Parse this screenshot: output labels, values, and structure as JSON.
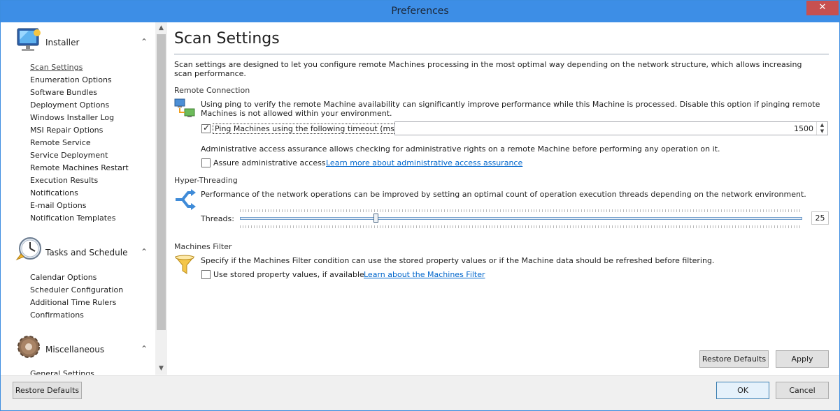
{
  "window": {
    "title": "Preferences",
    "close_glyph": "✕"
  },
  "sidebar": {
    "groups": [
      {
        "label": "Installer",
        "icon": "monitor-icon",
        "chevron": "⌃",
        "items": [
          "Scan Settings",
          "Enumeration Options",
          "Software Bundles",
          "Deployment Options",
          "Windows Installer Log",
          "MSI Repair Options",
          "Remote Service",
          "Service Deployment",
          "Remote Machines Restart",
          "Execution Results",
          "Notifications",
          "E-mail Options",
          "Notification Templates"
        ]
      },
      {
        "label": "Tasks and Schedule",
        "icon": "clock-icon",
        "chevron": "⌃",
        "items": [
          "Calendar Options",
          "Scheduler Configuration",
          "Additional Time Rulers",
          "Confirmations"
        ]
      },
      {
        "label": "Miscellaneous",
        "icon": "gear-icon",
        "chevron": "⌃",
        "items": [
          "General Settings"
        ]
      }
    ],
    "selected": "Scan Settings"
  },
  "main": {
    "title": "Scan Settings",
    "intro": "Scan settings are designed to let you configure remote Machines processing in the most optimal way depending on the network structure, which allows increasing scan performance.",
    "remote_connection": {
      "label": "Remote Connection",
      "ping_desc": "Using ping to verify the remote Machine availability can significantly improve performance while this Machine is processed. Disable this option if pinging remote Machines is not allowed within your environment.",
      "ping_checkbox": "Ping Machines using the following timeout (ms.):",
      "ping_checked": true,
      "timeout_value": "1500",
      "admin_desc": "Administrative access assurance allows checking for administrative rights on a remote Machine before performing any operation on it.",
      "admin_checkbox": "Assure administrative access",
      "admin_checked": false,
      "admin_link": "Learn more about administrative access assurance"
    },
    "hyper_threading": {
      "label": "Hyper-Threading",
      "desc": "Performance of the network operations can be improved by setting an optimal count of operation execution threads depending on the network environment.",
      "threads_label": "Threads:",
      "threads_value": "25"
    },
    "machines_filter": {
      "label": "Machines Filter",
      "desc": "Specify if the Machines Filter condition can use the stored property values or if the Machine data should be refreshed before filtering.",
      "checkbox": "Use stored property values, if available",
      "checked": false,
      "link": "Learn about the Machines Filter"
    },
    "restore_defaults": "Restore Defaults",
    "apply": "Apply"
  },
  "footer": {
    "restore_defaults": "Restore Defaults",
    "ok": "OK",
    "cancel": "Cancel"
  }
}
